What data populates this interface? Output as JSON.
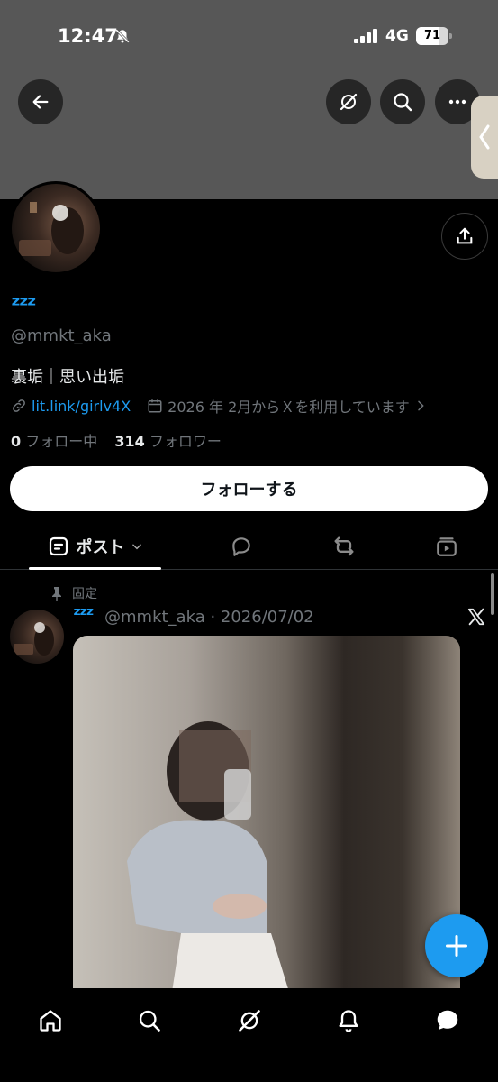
{
  "status_bar": {
    "time": "12:47",
    "network": "4G",
    "battery": "71",
    "battery_level": 0.71
  },
  "profile": {
    "display_name": "ᶻᶻᶻ",
    "handle": "@mmkt_aka",
    "bio": "裏垢｜思い出垢",
    "link": "lit.link/girlv4X",
    "joined": "2026 年 2月からＸを利用しています",
    "following_count": "0",
    "following_label": "フォロー中",
    "followers_count": "314",
    "followers_label": "フォロワー",
    "follow_button": "フォローする"
  },
  "tabs": {
    "active_label": "ポスト"
  },
  "post": {
    "pinned_label": "固定",
    "display_name": "ᶻᶻᶻ",
    "handle_date": "@mmkt_aka · 2026/07/02"
  },
  "colors": {
    "accent": "#1d9bf0",
    "banner": "#575757",
    "background": "#000000"
  }
}
